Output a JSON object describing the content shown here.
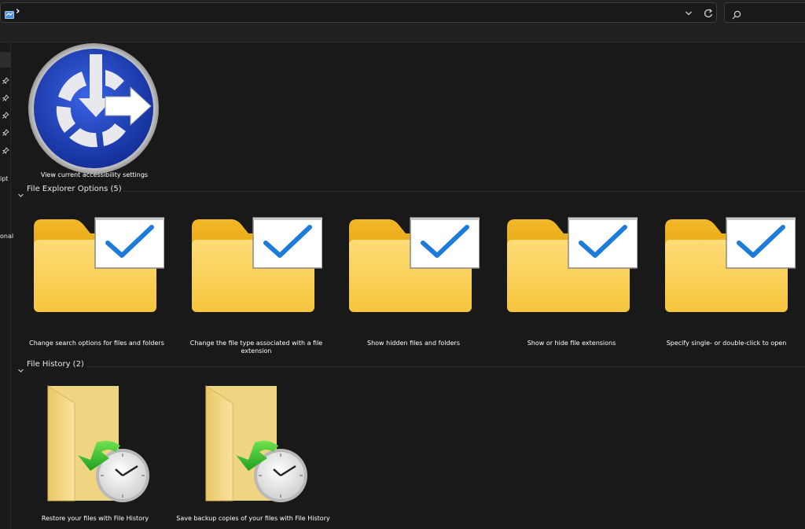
{
  "address_bar": {
    "path_chevron": "›",
    "dropdown_icon": "chevron-down-icon",
    "refresh_icon": "refresh-icon",
    "location_icon": "control-panel-icon"
  },
  "search": {
    "placeholder": "",
    "icon": "search-icon"
  },
  "nav": {
    "fragments": [
      "ipt",
      "onal"
    ]
  },
  "groups": [
    {
      "title": "",
      "items": [
        {
          "label": "View current accessibility settings",
          "icon": "accessibility-icon"
        }
      ]
    },
    {
      "title": "File Explorer Options (5)",
      "items": [
        {
          "label": "Change search options for files and folders",
          "icon": "folder-options-icon"
        },
        {
          "label": "Change the file type associated with a file extension",
          "icon": "folder-options-icon"
        },
        {
          "label": "Show hidden files and folders",
          "icon": "folder-options-icon"
        },
        {
          "label": "Show or hide file extensions",
          "icon": "folder-options-icon"
        },
        {
          "label": "Specify single- or double-click to open",
          "icon": "folder-options-icon"
        }
      ]
    },
    {
      "title": "File History (2)",
      "items": [
        {
          "label": "Restore your files with File History",
          "icon": "file-history-icon"
        },
        {
          "label": "Save backup copies of your files with File History",
          "icon": "file-history-icon"
        }
      ]
    }
  ],
  "colors": {
    "background": "#191919",
    "chrome": "#202020",
    "accessibility_blue": "#1f3fae",
    "folder_yellow": "#f8cd52",
    "check_blue": "#1d7bd9",
    "history_green": "#2fb82f"
  }
}
